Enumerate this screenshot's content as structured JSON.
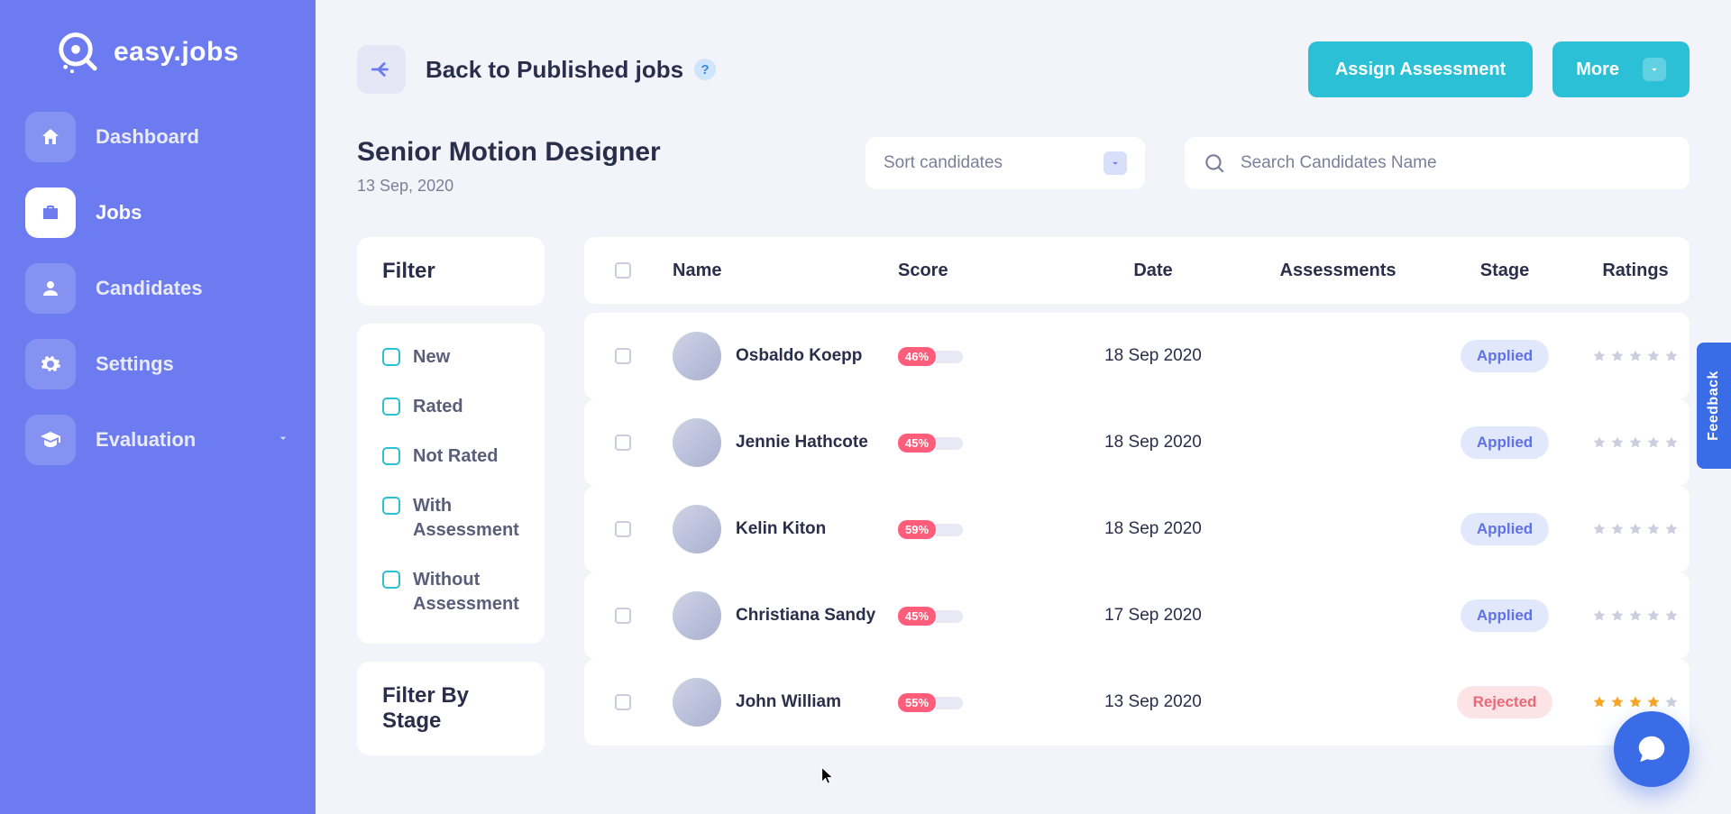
{
  "brand": {
    "name": "easy.jobs"
  },
  "nav": {
    "dashboard": "Dashboard",
    "jobs": "Jobs",
    "candidates": "Candidates",
    "settings": "Settings",
    "evaluation": "Evaluation"
  },
  "topbar": {
    "back_label": "Back to Published jobs",
    "assign_label": "Assign Assessment",
    "more_label": "More"
  },
  "job": {
    "title": "Senior Motion Designer",
    "date": "13 Sep, 2020"
  },
  "sort": {
    "placeholder": "Sort candidates"
  },
  "search": {
    "placeholder": "Search Candidates Name"
  },
  "filters": {
    "heading": "Filter",
    "stage_heading": "Filter By Stage",
    "items": {
      "new": "New",
      "rated": "Rated",
      "not_rated": "Not Rated",
      "with_assessment": "With Assessment",
      "without_assessment": "Without Assessment"
    }
  },
  "table": {
    "headers": {
      "name": "Name",
      "score": "Score",
      "date": "Date",
      "assessments": "Assessments",
      "stage": "Stage",
      "ratings": "Ratings"
    },
    "rows": [
      {
        "name": "Osbaldo Koepp",
        "score": "46%",
        "date": "18 Sep 2020",
        "assessments": "",
        "stage": "Applied",
        "stage_class": "applied",
        "rating": 0
      },
      {
        "name": "Jennie Hathcote",
        "score": "45%",
        "date": "18 Sep 2020",
        "assessments": "",
        "stage": "Applied",
        "stage_class": "applied",
        "rating": 0
      },
      {
        "name": "Kelin Kiton",
        "score": "59%",
        "date": "18 Sep 2020",
        "assessments": "",
        "stage": "Applied",
        "stage_class": "applied",
        "rating": 0
      },
      {
        "name": "Christiana Sandy",
        "score": "45%",
        "date": "17 Sep 2020",
        "assessments": "",
        "stage": "Applied",
        "stage_class": "applied",
        "rating": 0
      },
      {
        "name": "John William",
        "score": "55%",
        "date": "13 Sep 2020",
        "assessments": "",
        "stage": "Rejected",
        "stage_class": "rejected",
        "rating": 4
      }
    ]
  },
  "misc": {
    "feedback": "Feedback"
  }
}
